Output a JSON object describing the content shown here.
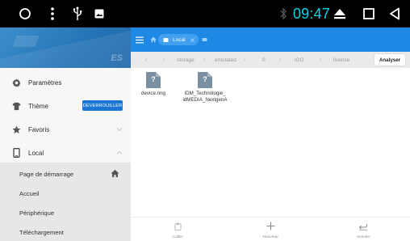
{
  "statusbar": {
    "icons": [
      "circle-icon",
      "overflow-menu-icon",
      "usb-icon",
      "image-icon",
      "bluetooth-icon",
      "eject-icon",
      "square-icon",
      "back-triangle-icon"
    ],
    "time": "09:47"
  },
  "drawer": {
    "logo": "ES",
    "menu": [
      {
        "label": "Paramètres",
        "icon": "gear-icon"
      },
      {
        "label": "Thème",
        "icon": "shirt-icon",
        "badge": "DÉVERROUILLER"
      },
      {
        "label": "Favoris",
        "icon": "star-icon",
        "chevron": "down"
      },
      {
        "label": "Local",
        "icon": "phone-icon",
        "chevron": "up"
      }
    ],
    "sub_items": [
      {
        "label": "Page de démarrage",
        "icon": "home-icon"
      },
      {
        "label": "Accueil"
      },
      {
        "label": "Périphérique"
      },
      {
        "label": "Téléchargement"
      }
    ]
  },
  "appbar": {
    "tab_label": "Local",
    "icons": [
      "hamburger-icon",
      "home-icon",
      "close-icon",
      "tabs-icon"
    ]
  },
  "breadcrumb": {
    "items": [
      "/",
      "storage",
      "emulated",
      "0",
      "iGO",
      "license"
    ],
    "analyse_button": "Analyser"
  },
  "files": [
    {
      "name": "device.nng",
      "icon_glyph": "?"
    },
    {
      "name": "IDM_Technologie_\nidMEDIA_NextgenA",
      "icon_glyph": "?"
    }
  ],
  "bottombar": [
    {
      "label": "Coller",
      "icon": "paste-icon"
    },
    {
      "label": "Nouveau",
      "icon": "plus-icon"
    },
    {
      "label": "Annuler",
      "icon": "undo-icon"
    }
  ],
  "colors": {
    "accent": "#1e88e5",
    "statusbar": "#000000",
    "time": "#0bd3e8",
    "badge": "#1a76d2",
    "file_icon": "#7b8fa3"
  }
}
